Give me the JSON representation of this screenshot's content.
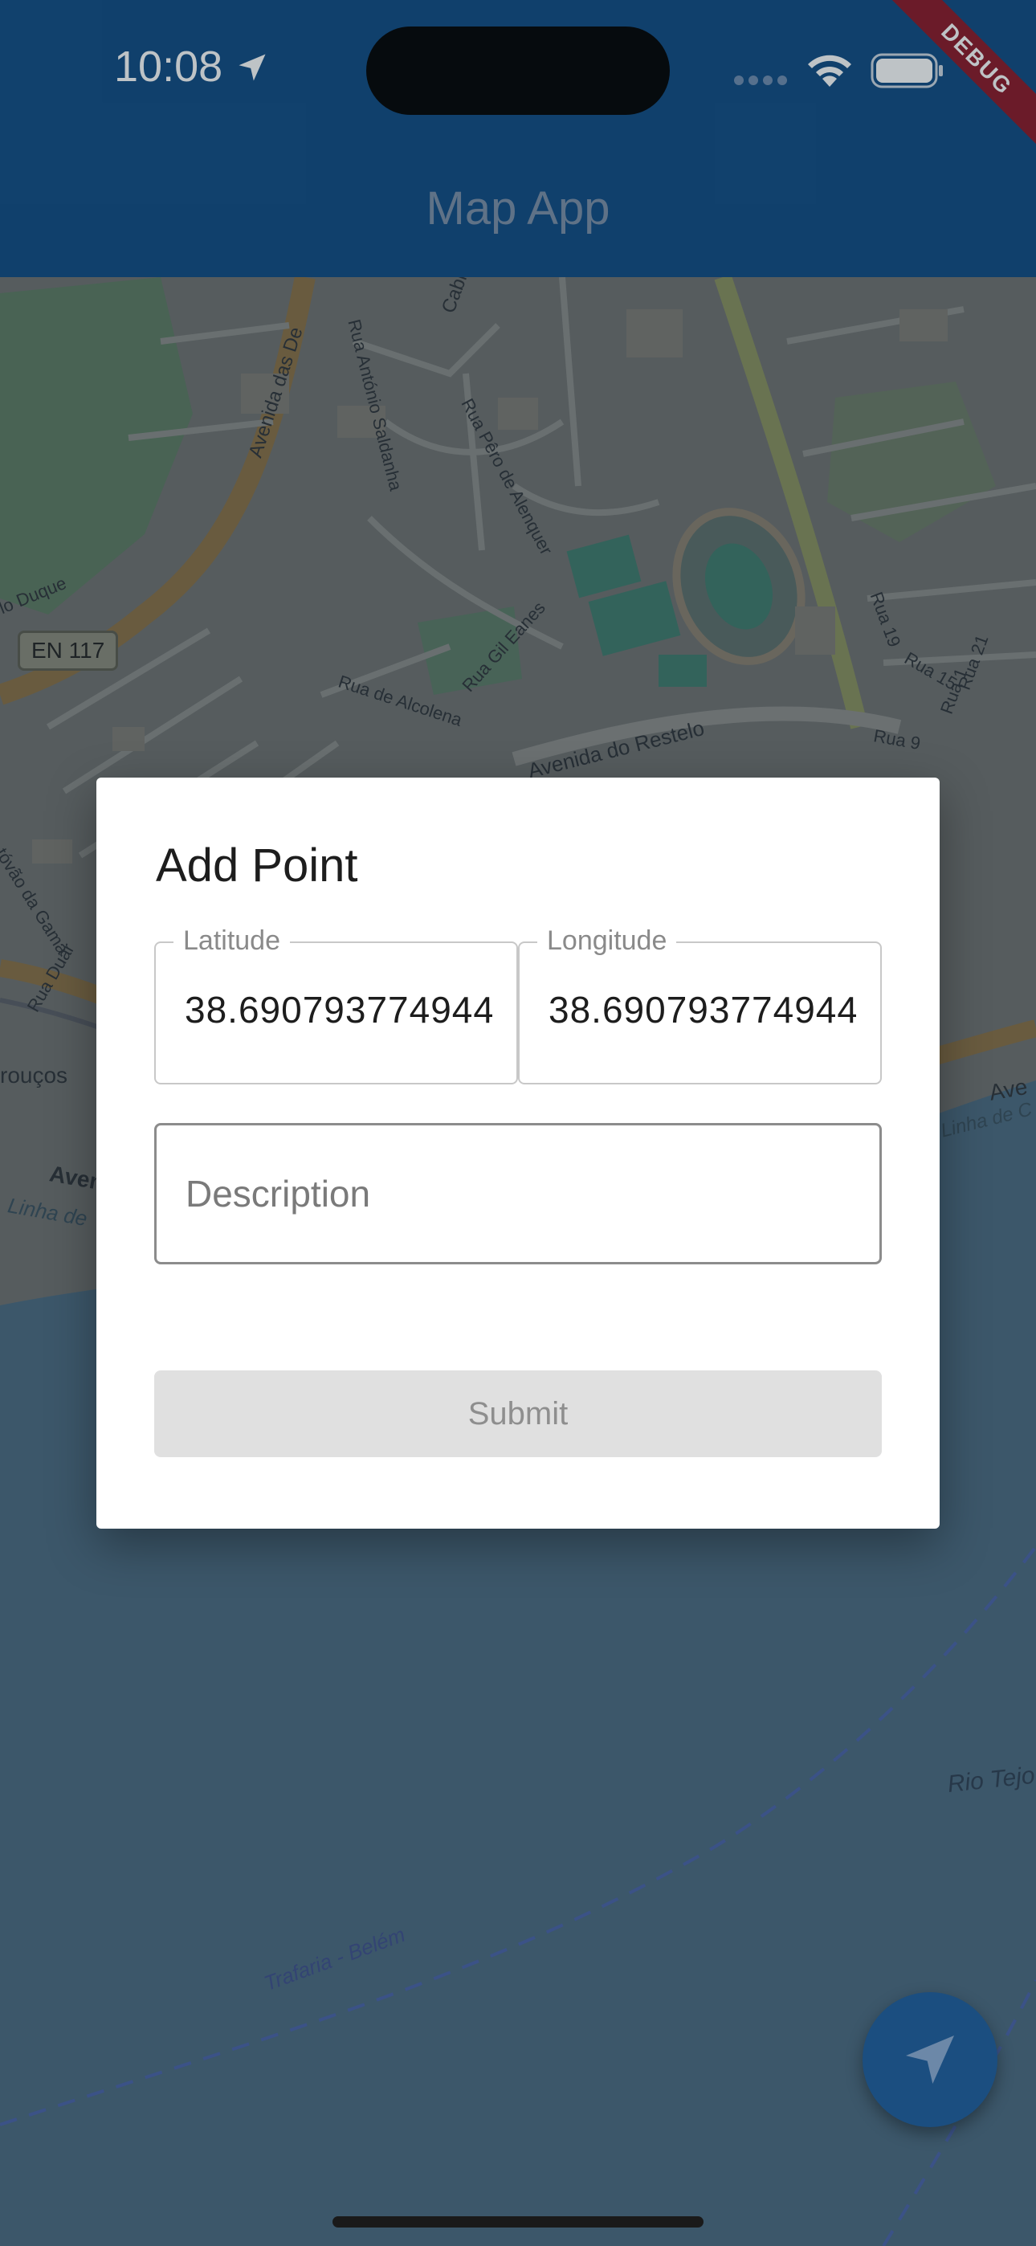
{
  "status_bar": {
    "time": "10:08",
    "location_icon": "location-arrow-icon",
    "wifi_icon": "wifi-icon",
    "battery_icon": "battery-icon"
  },
  "debug_banner": "DEBUG",
  "app_bar": {
    "title": "Map App"
  },
  "map": {
    "labels": [
      "Avenida das De",
      "Rua António Saldanha",
      "Cabral",
      "Rua Pêro de Alenquer",
      "Rua Gil Eanes",
      "Rua de Alcolena",
      "Avenida do Restelo",
      "lo Duque",
      "EN 117",
      "Rua 19",
      "Rua 15",
      "Rua 21",
      "Rua 9",
      "Rua 1",
      "Rua Duar",
      "tóvão da Gama",
      "rouços",
      "Aven",
      "Linha de",
      "Ave",
      "Linha de C",
      "Rio Tejo",
      "Trafaria - Belém"
    ]
  },
  "dialog": {
    "title": "Add Point",
    "latitude": {
      "label": "Latitude",
      "value": "38.690793774944"
    },
    "longitude": {
      "label": "Longitude",
      "value": "38.690793774944"
    },
    "description": {
      "placeholder": "Description",
      "value": ""
    },
    "submit_label": "Submit"
  },
  "fab": {
    "icon": "navigation-arrow-icon"
  }
}
